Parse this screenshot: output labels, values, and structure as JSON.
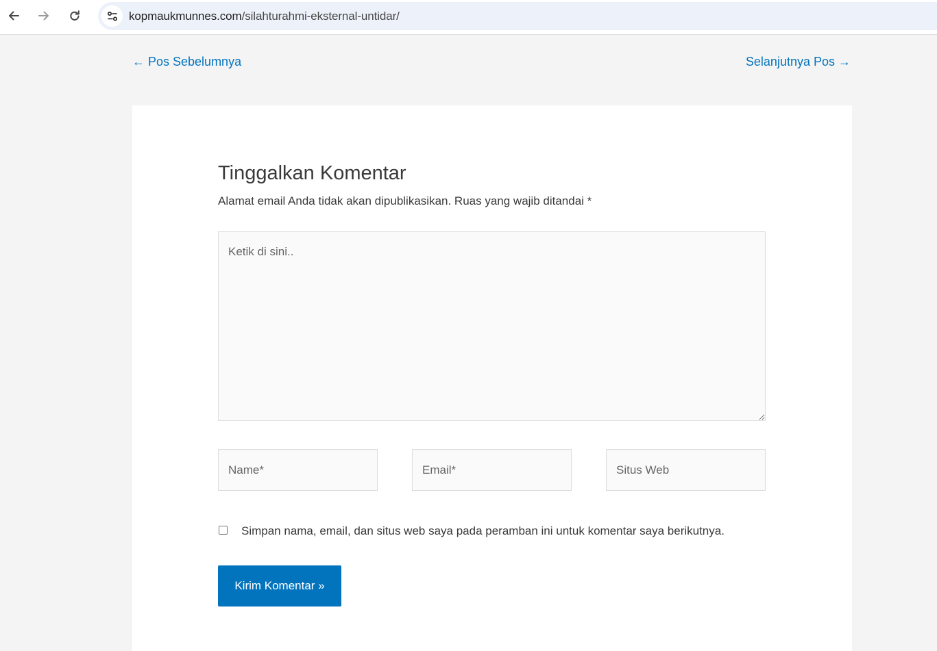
{
  "browser": {
    "url_domain": "kopmaukmunnes.com",
    "url_path": "/silahturahmi-eksternal-untidar/",
    "icons": {
      "back": "arrow-left-icon",
      "forward": "arrow-right-icon",
      "reload": "reload-icon",
      "site_info": "tune-icon"
    }
  },
  "post_nav": {
    "prev_label": "← Pos Sebelumnya",
    "next_label": "Selanjutnya Pos →"
  },
  "comment_form": {
    "title": "Tinggalkan Komentar",
    "notes": "Alamat email Anda tidak akan dipublikasikan. Ruas yang wajib ditandai *",
    "comment_placeholder": "Ketik di sini..",
    "comment_value": "",
    "name_placeholder": "Name*",
    "name_value": "",
    "email_placeholder": "Email*",
    "email_value": "",
    "website_placeholder": "Situs Web",
    "website_value": "",
    "cookies_label": "Simpan nama, email, dan situs web saya pada peramban ini untuk komentar saya berikutnya.",
    "cookies_checked": false,
    "submit_label": "Kirim Komentar »"
  },
  "colors": {
    "accent": "#0274be",
    "page_background": "#f4f4f4",
    "card_background": "#ffffff",
    "field_background": "#fafafa",
    "text": "#3a3a3a"
  }
}
